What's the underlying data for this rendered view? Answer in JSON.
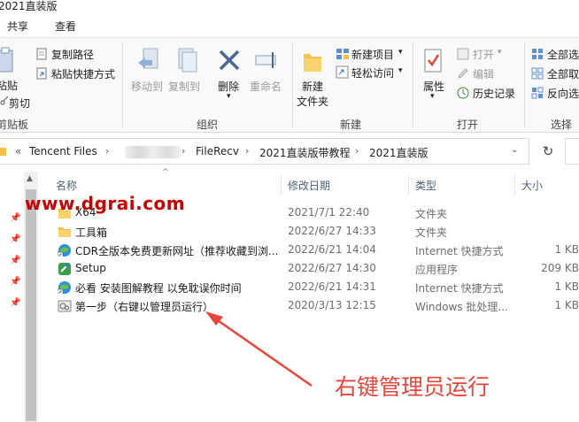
{
  "window": {
    "title": "2021直装版"
  },
  "tabs": [
    {
      "label": "共享"
    },
    {
      "label": "查看"
    }
  ],
  "ribbon": {
    "clipboard": {
      "label": "剪贴板",
      "paste": "粘贴",
      "cut": "剪切",
      "copy_path": "复制路径",
      "paste_shortcut": "粘贴快捷方式"
    },
    "organize": {
      "label": "组织",
      "move_to": "移动到",
      "copy_to": "复制到",
      "delete": "删除",
      "rename": "重命名"
    },
    "new": {
      "label": "新建",
      "new_folder_1": "新建",
      "new_folder_2": "文件夹",
      "new_item": "新建项目",
      "easy_access": "轻松访问"
    },
    "open": {
      "label": "打开",
      "properties": "属性",
      "open": "打开",
      "edit": "编辑",
      "history": "历史记录"
    },
    "select": {
      "label": "选择",
      "select_all": "全部选",
      "select_none": "全部取",
      "invert": "反向选"
    }
  },
  "address": {
    "back_chevron": "«",
    "crumbs": [
      "Tencent Files",
      "FileRecv",
      "2021直装版带教程",
      "2021直装版"
    ]
  },
  "columns": {
    "name": "名称",
    "modified": "修改日期",
    "type": "类型",
    "size": "大小"
  },
  "files": [
    {
      "name": "X64",
      "modified": "2021/7/1 22:40",
      "type": "文件夹",
      "size": "",
      "icon": "folder-icon"
    },
    {
      "name": "工具箱",
      "modified": "2022/6/27 14:33",
      "type": "文件夹",
      "size": "",
      "icon": "folder-icon"
    },
    {
      "name": "CDR全版本免费更新网址（推荐收藏到浏...",
      "modified": "2022/6/21 14:04",
      "type": "Internet 快捷方式",
      "size": "1 KB",
      "icon": "internet-shortcut-icon"
    },
    {
      "name": "Setup",
      "modified": "2022/6/27 14:30",
      "type": "应用程序",
      "size": "209 KB",
      "icon": "setup-app-icon"
    },
    {
      "name": "必看 安装图解教程 以免耽误你时间",
      "modified": "2022/6/21 14:31",
      "type": "Internet 快捷方式",
      "size": "1 KB",
      "icon": "internet-shortcut-icon"
    },
    {
      "name": "第一步（右键以管理员运行）",
      "modified": "2020/3/13 12:15",
      "type": "Windows 批处理...",
      "size": "1 KB",
      "icon": "batch-file-icon"
    }
  ],
  "overlay": {
    "watermark": "www.dgrai.com",
    "annotation": "右键管理员运行"
  },
  "colors": {
    "accent": "#0078d7",
    "folder": "#f4c149",
    "annotation": "#e8453c",
    "watermark": "#c40000"
  }
}
